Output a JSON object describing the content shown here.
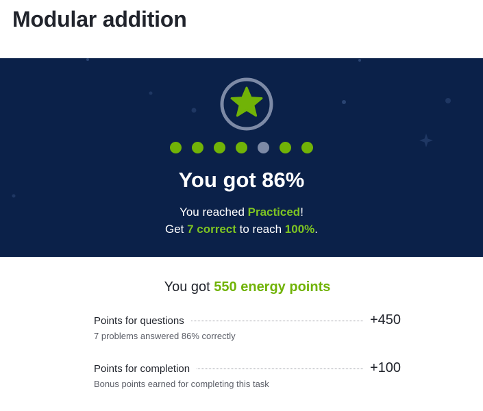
{
  "page": {
    "title": "Modular addition"
  },
  "result": {
    "score_text": "You got 86%",
    "progress_dots": [
      "correct",
      "correct",
      "correct",
      "correct",
      "incorrect",
      "correct",
      "correct"
    ],
    "mastery_line": {
      "prefix": "You reached ",
      "level": "Practiced",
      "suffix": "!"
    },
    "next_line": {
      "prefix": "Get ",
      "count": "7 correct",
      "middle": " to reach ",
      "target": "100%",
      "suffix": "."
    }
  },
  "energy": {
    "prefix": "You got ",
    "points": "550 energy points",
    "rows": [
      {
        "label": "Points for questions",
        "value": "+450",
        "detail": "7 problems answered 86% correctly"
      },
      {
        "label": "Points for completion",
        "value": "+100",
        "detail": "Bonus points earned for completing this task"
      }
    ]
  },
  "colors": {
    "banner": "#0b2149",
    "accent_green": "#71b307",
    "incorrect_dot": "#7d8aa6"
  },
  "icons": {
    "badge": "star-icon"
  }
}
